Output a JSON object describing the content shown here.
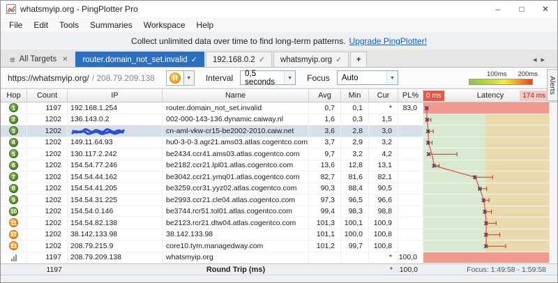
{
  "window": {
    "title": "whatsmyip.org - PingPlotter Pro"
  },
  "menu": {
    "items": [
      "File",
      "Edit",
      "Tools",
      "Summaries",
      "Workspace",
      "Help"
    ]
  },
  "banner": {
    "text": "Collect unlimited data over time to find long-term patterns.",
    "link_label": "Upgrade PingPlotter!"
  },
  "tabs": {
    "all_targets_label": "All Targets",
    "new_tab_label": "+",
    "items": [
      {
        "label": "router.domain_not_set.invalid",
        "active": true
      },
      {
        "label": "192.168.0.2",
        "active": false
      },
      {
        "label": "whatsmyip.org",
        "active": false
      }
    ]
  },
  "toolbar": {
    "url": "https://whatsmyip.org/",
    "ip_text": "/ 208.79.209.138",
    "interval_label": "Interval",
    "interval_value": "0,5 seconds",
    "focus_label": "Focus",
    "focus_value": "Auto",
    "legend_100": "100ms",
    "legend_200": "200ms"
  },
  "side": {
    "alerts_label": "Alerts"
  },
  "table": {
    "headers": {
      "hop": "Hop",
      "count": "Count",
      "ip": "IP",
      "name": "Name",
      "avg": "Avg",
      "min": "Min",
      "cur": "Cur",
      "pl": "PL%",
      "latency": "Latency",
      "scale_min": "0 ms",
      "scale_max": "174 ms"
    },
    "rows": [
      {
        "hop": "1",
        "hop_color": "green",
        "count": "1197",
        "ip": "192.168.1.254",
        "name": "router.domain_not_set.invalid",
        "avg": "0,7",
        "min": "0,1",
        "cur": "*",
        "pl": "83,0",
        "loss": true
      },
      {
        "hop": "2",
        "hop_color": "green",
        "count": "1202",
        "ip": "136.143.0.2",
        "name": "002-000-143-136.dynamic.caiway.nl",
        "avg": "1,6",
        "min": "0,3",
        "cur": "1,5",
        "pl": ""
      },
      {
        "hop": "3",
        "hop_color": "green",
        "count": "1202",
        "ip": "",
        "ip_redacted": true,
        "name": "cn-aml-vkw-cr15-be2002-2010.caiw.net",
        "avg": "3,6",
        "min": "2,8",
        "cur": "3,0",
        "pl": "",
        "selected": true
      },
      {
        "hop": "4",
        "hop_color": "green",
        "count": "1202",
        "ip": "149.11.64.93",
        "name": "hu0-3-0-3.agr21.ams03.atlas.cogentco.com",
        "avg": "3,7",
        "min": "2,9",
        "cur": "3,2",
        "pl": ""
      },
      {
        "hop": "5",
        "hop_color": "green",
        "count": "1202",
        "ip": "130.117.2.242",
        "name": "be2434.ccr41.ams03.atlas.cogentco.com",
        "avg": "9,7",
        "min": "3,2",
        "cur": "4,2",
        "pl": ""
      },
      {
        "hop": "6",
        "hop_color": "green",
        "count": "1202",
        "ip": "154.54.77.246",
        "name": "be2182.ccr21.lpl01.atlas.cogentco.com",
        "avg": "13,6",
        "min": "12,8",
        "cur": "13,1",
        "pl": ""
      },
      {
        "hop": "7",
        "hop_color": "green",
        "count": "1202",
        "ip": "154.54.44.162",
        "name": "be3042.ccr21.ymq01.atlas.cogentco.com",
        "avg": "82,7",
        "min": "81,6",
        "cur": "82,1",
        "pl": ""
      },
      {
        "hop": "8",
        "hop_color": "green",
        "count": "1202",
        "ip": "154.54.41.205",
        "name": "be3259.ccr31.yyz02.atlas.cogentco.com",
        "avg": "90,3",
        "min": "88,4",
        "cur": "90,5",
        "pl": ""
      },
      {
        "hop": "9",
        "hop_color": "green",
        "count": "1202",
        "ip": "154.54.31.225",
        "name": "be2993.ccr21.cle04.atlas.cogentco.com",
        "avg": "97,3",
        "min": "96,5",
        "cur": "96,6",
        "pl": ""
      },
      {
        "hop": "10",
        "hop_color": "green",
        "count": "1202",
        "ip": "154.54.0.146",
        "name": "be3744.rcr51.tol01.atlas.cogentco.com",
        "avg": "99,4",
        "min": "98,3",
        "cur": "98,8",
        "pl": ""
      },
      {
        "hop": "11",
        "hop_color": "orange",
        "count": "1202",
        "ip": "154.54.82.138",
        "name": "be2123.rcr21.dtw04.atlas.cogentco.com",
        "avg": "101,3",
        "min": "100,1",
        "cur": "100,9",
        "pl": ""
      },
      {
        "hop": "12",
        "hop_color": "orange",
        "count": "1202",
        "ip": "38.142.133.98",
        "name": "38.142.133.98",
        "avg": "101,1",
        "min": "100,0",
        "cur": "100,8",
        "pl": ""
      },
      {
        "hop": "13",
        "hop_color": "orange",
        "count": "1202",
        "ip": "208.79.215.9",
        "name": "core10.tym.managedway.com",
        "avg": "101,2",
        "min": "99,7",
        "cur": "100,8",
        "pl": ""
      },
      {
        "hop": "",
        "icon": "chart",
        "count": "1197",
        "ip": "208.79.209.138",
        "name": "whatsmyip.org",
        "avg": "",
        "min": "",
        "cur": "*",
        "pl": "100,0",
        "loss": true
      }
    ],
    "footer": {
      "count": "1197",
      "label": "Round Trip (ms)",
      "cur": "*",
      "pl": "100,0",
      "focus": "Focus: 1:49:58 - 1:59:58"
    }
  },
  "colors": {
    "active_tab": "#2c6fbd",
    "zone_ok": "#d9e9cf",
    "zone_warn": "#e9d9ab",
    "zone_loss": "#f0998f",
    "line": "#e04a3a",
    "whisker": "#b03a2e",
    "marker": "#53306b",
    "hop_green": "#4e8427",
    "hop_orange": "#ec7c09"
  },
  "chart_data": {
    "type": "scatter",
    "title": "Latency",
    "orientation": "horizontal-per-hop-row",
    "x_axis": {
      "label_min": "0 ms",
      "label_max": "174 ms",
      "min": 0,
      "max": 174,
      "unit": "ms"
    },
    "zones": [
      {
        "from": 0,
        "to": 100,
        "color": "#d9e9cf"
      },
      {
        "from": 100,
        "to": 174,
        "color": "#e9d9ab"
      }
    ],
    "points": [
      {
        "hop": 1,
        "min": 0.1,
        "avg": 0.7,
        "cur": null,
        "max_est": 3,
        "loss_pct": 83.0,
        "loss_row": true
      },
      {
        "hop": 2,
        "min": 0.3,
        "avg": 1.6,
        "cur": 1.5,
        "max_est": 8
      },
      {
        "hop": 3,
        "min": 2.8,
        "avg": 3.6,
        "cur": 3.0,
        "max_est": 12
      },
      {
        "hop": 4,
        "min": 2.9,
        "avg": 3.7,
        "cur": 3.2,
        "max_est": 10
      },
      {
        "hop": 5,
        "min": 3.2,
        "avg": 9.7,
        "cur": 4.2,
        "max_est": 52
      },
      {
        "hop": 6,
        "min": 12.8,
        "avg": 13.6,
        "cur": 13.1,
        "max_est": 22
      },
      {
        "hop": 7,
        "min": 81.6,
        "avg": 82.7,
        "cur": 82.1,
        "max_est": 112
      },
      {
        "hop": 8,
        "min": 88.4,
        "avg": 90.3,
        "cur": 90.5,
        "max_est": 102
      },
      {
        "hop": 9,
        "min": 96.5,
        "avg": 97.3,
        "cur": 96.6,
        "max_est": 106
      },
      {
        "hop": 10,
        "min": 98.3,
        "avg": 99.4,
        "cur": 98.8,
        "max_est": 110
      },
      {
        "hop": 11,
        "min": 100.1,
        "avg": 101.3,
        "cur": 100.9,
        "max_est": 118
      },
      {
        "hop": 12,
        "min": 100.0,
        "avg": 101.1,
        "cur": 100.8,
        "max_est": 124
      },
      {
        "hop": 13,
        "min": 99.7,
        "avg": 101.2,
        "cur": 100.8,
        "max_est": 134
      },
      {
        "hop": null,
        "min": null,
        "avg": null,
        "cur": null,
        "max_est": null,
        "loss_pct": 100.0,
        "loss_row": true
      }
    ]
  }
}
